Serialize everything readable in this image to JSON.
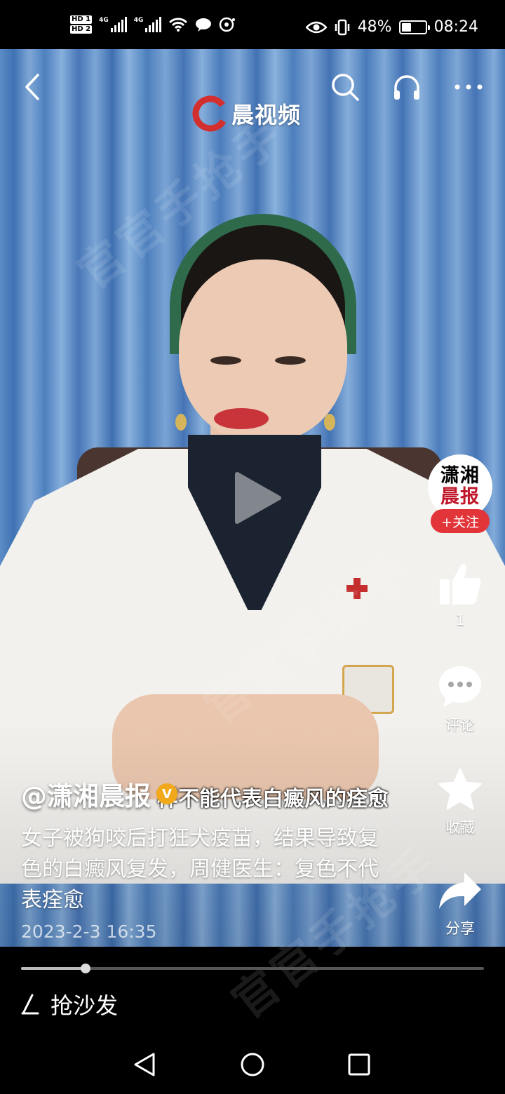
{
  "status_bar": {
    "sim_labels": [
      "HD 1",
      "HD 2"
    ],
    "network_labels": [
      "4G",
      "4G"
    ],
    "battery_percent": "48%",
    "battery_level": 0.48,
    "time": "08:24"
  },
  "top_bar": {
    "brand_name": "晨视频",
    "brand_color": "#d42f2f"
  },
  "right_rail": {
    "avatar_line1": "潇湘",
    "avatar_line2": "晨报",
    "follow_label": "+关注",
    "like_count": "1",
    "comment_label": "评论",
    "favorite_label": "收藏",
    "share_label": "分享"
  },
  "video": {
    "author": "@潇湘晨报",
    "verified_mark": "V",
    "subtitle": "样不能代表白癜风的痊愈",
    "description": "女子被狗咬后打狂犬疫苗，结果导致复色的白癜风复发，周健医生：复色不代表痊愈",
    "date": "2023-2-3 16:35",
    "progress": 0.14
  },
  "bottom": {
    "comment_prompt": "抢沙发"
  },
  "watermark_text": "官官手抢手",
  "colors": {
    "follow_button": "#e2353a",
    "verified_badge": "#f1a91a"
  }
}
